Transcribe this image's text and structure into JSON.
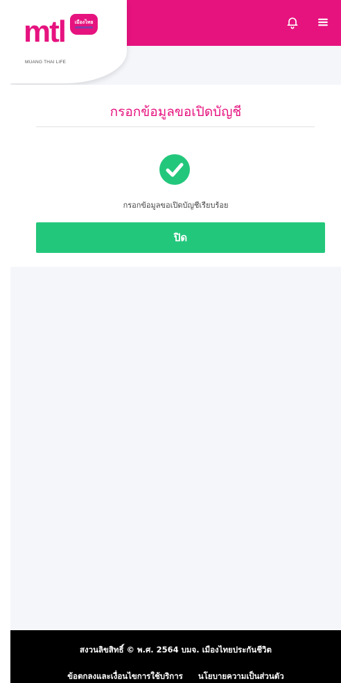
{
  "brand": {
    "logo_text": "mtl",
    "logo_badge_text": "เมืองไทย",
    "tagline": "MUANG THAI LIFE",
    "primary_color": "#e6137f",
    "success_color": "#23c77c"
  },
  "header": {
    "icons": [
      "bell-icon",
      "menu-icon"
    ]
  },
  "main": {
    "title": "กรอกข้อมูลขอเปิดบัญชี",
    "success_icon": "check-circle-icon",
    "success_message": "กรอกข้อมูลขอเปิดบัญชีเรียบร้อย",
    "close_label": "ปิด"
  },
  "footer": {
    "copyright": "สงวนลิขสิทธิ์ © พ.ศ. 2564 บมจ. เมืองไทยประกันชีวิต",
    "links": [
      {
        "label": "ข้อตกลงและเงื่อนไขการใช้บริการ"
      },
      {
        "label": "นโยบายความเป็นส่วนตัว"
      }
    ]
  }
}
